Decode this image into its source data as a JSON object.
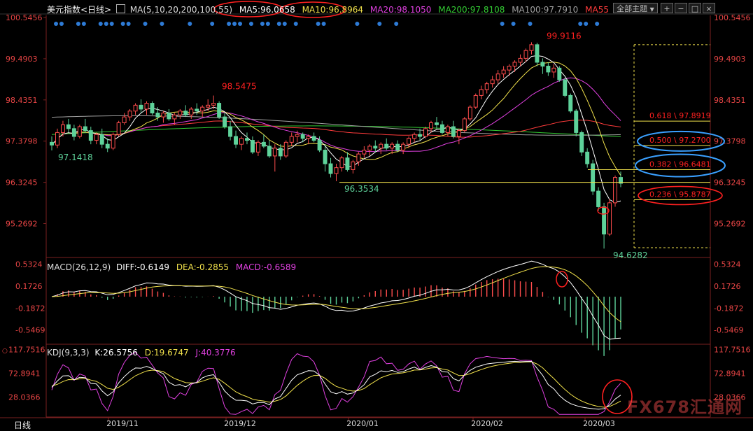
{
  "header": {
    "title": "美元指数<日线>",
    "ma_label": "MA(5,10,20,200,100,55)",
    "ma5": "MA5:96.0658",
    "ma10": "MA10:96.8964",
    "ma20": "MA20:98.1050",
    "ma200": "MA200:97.8108",
    "ma100": "MA100:97.7910",
    "ma55": "MA55",
    "select_label": "全部主题",
    "select_arrow": "▼"
  },
  "macd": {
    "label": "MACD(26,12,9)",
    "diff": "DIFF:-0.6149",
    "dea": "DEA:-0.2855",
    "macd": "MACD:-0.6589"
  },
  "kdj": {
    "label": "KDJ(9,3,3)",
    "k": "K:26.5756",
    "d": "D:19.6747",
    "j": "J:40.3776"
  },
  "footer": {
    "period": "日线",
    "dates": [
      "2019/11",
      "2019/12",
      "2020/01",
      "2020/02",
      "2020/03"
    ]
  },
  "watermark": "FX678汇通网",
  "colors": {
    "up": "#ff4d4d",
    "down": "#5ed29a",
    "ma5": "#ffffff",
    "ma10": "#f0e04b",
    "ma20": "#e040e0",
    "ma200": "#33cc33",
    "ma100": "#a0a0a0",
    "ma55": "#ff3b3b",
    "fib": "#f0e04b",
    "annotation": "#ff2020",
    "annotation_blue": "#3aa0ff"
  },
  "chart_data": [
    {
      "type": "candlestick",
      "title": "美元指数<日线>",
      "y_ticks": [
        "100.5456",
        "99.4903",
        "98.4351",
        "97.3798",
        "96.3245",
        "95.2692"
      ],
      "ylim": [
        94.4,
        100.6
      ],
      "x_ticks": [
        "2019/11",
        "2019/12",
        "2020/01",
        "2020/02",
        "2020/03"
      ],
      "candles": [
        [
          97.35,
          97.5,
          97.1418,
          97.28
        ],
        [
          97.28,
          97.7,
          97.2,
          97.6
        ],
        [
          97.6,
          97.9,
          97.5,
          97.8
        ],
        [
          97.8,
          97.95,
          97.6,
          97.7
        ],
        [
          97.7,
          97.8,
          97.4,
          97.5
        ],
        [
          97.5,
          97.8,
          97.45,
          97.75
        ],
        [
          97.75,
          97.95,
          97.6,
          97.65
        ],
        [
          97.65,
          97.75,
          97.3,
          97.4
        ],
        [
          97.4,
          97.6,
          97.3,
          97.55
        ],
        [
          97.55,
          97.7,
          97.2,
          97.3
        ],
        [
          97.3,
          97.45,
          97.1,
          97.2
        ],
        [
          97.2,
          97.6,
          97.15,
          97.55
        ],
        [
          97.55,
          97.9,
          97.5,
          97.85
        ],
        [
          97.85,
          98.1,
          97.8,
          98.0
        ],
        [
          98.0,
          98.2,
          97.9,
          98.15
        ],
        [
          98.15,
          98.35,
          98.05,
          98.3
        ],
        [
          98.3,
          98.45,
          98.1,
          98.2
        ],
        [
          98.2,
          98.4,
          98.05,
          98.35
        ],
        [
          98.35,
          98.4,
          98.05,
          98.1
        ],
        [
          98.1,
          98.25,
          97.9,
          98.0
        ],
        [
          98.0,
          98.15,
          97.85,
          98.1
        ],
        [
          98.1,
          98.2,
          97.9,
          97.95
        ],
        [
          97.95,
          98.1,
          97.8,
          98.05
        ],
        [
          98.05,
          98.2,
          97.95,
          98.15
        ],
        [
          98.15,
          98.3,
          98.0,
          98.05
        ],
        [
          98.05,
          98.25,
          97.95,
          98.2
        ],
        [
          98.2,
          98.35,
          98.05,
          98.15
        ],
        [
          98.15,
          98.3,
          98.0,
          98.25
        ],
        [
          98.25,
          98.45,
          98.15,
          98.3
        ],
        [
          98.3,
          98.5475,
          98.2,
          98.35
        ],
        [
          98.35,
          98.4,
          97.95,
          98.0
        ],
        [
          98.0,
          98.1,
          97.7,
          97.75
        ],
        [
          97.75,
          97.9,
          97.4,
          97.5
        ],
        [
          97.5,
          97.65,
          97.2,
          97.3
        ],
        [
          97.3,
          97.5,
          97.15,
          97.45
        ],
        [
          97.45,
          97.6,
          97.3,
          97.4
        ],
        [
          97.4,
          97.5,
          97.05,
          97.1
        ],
        [
          97.1,
          97.4,
          97.0,
          97.35
        ],
        [
          97.35,
          97.55,
          97.2,
          97.25
        ],
        [
          97.25,
          97.4,
          96.95,
          97.0
        ],
        [
          97.0,
          97.3,
          96.6,
          97.2
        ],
        [
          97.2,
          97.3,
          96.9,
          97.0
        ],
        [
          97.0,
          97.4,
          96.95,
          97.35
        ],
        [
          97.35,
          97.6,
          97.25,
          97.5
        ],
        [
          97.5,
          97.65,
          97.35,
          97.55
        ],
        [
          97.55,
          97.6,
          97.35,
          97.45
        ],
        [
          97.45,
          97.55,
          97.3,
          97.5
        ],
        [
          97.5,
          97.6,
          97.35,
          97.4
        ],
        [
          97.4,
          97.5,
          97.1,
          97.15
        ],
        [
          97.15,
          97.3,
          96.6,
          96.8
        ],
        [
          96.8,
          96.95,
          96.45,
          96.55
        ],
        [
          96.55,
          96.8,
          96.3534,
          96.7
        ],
        [
          96.7,
          97.0,
          96.6,
          96.95
        ],
        [
          96.95,
          97.1,
          96.6,
          96.65
        ],
        [
          96.65,
          96.9,
          96.55,
          96.85
        ],
        [
          96.85,
          97.1,
          96.75,
          97.05
        ],
        [
          97.05,
          97.25,
          96.95,
          97.15
        ],
        [
          97.15,
          97.3,
          97.0,
          97.25
        ],
        [
          97.25,
          97.4,
          97.1,
          97.2
        ],
        [
          97.2,
          97.35,
          97.05,
          97.3
        ],
        [
          97.3,
          97.45,
          97.15,
          97.2
        ],
        [
          97.2,
          97.35,
          97.05,
          97.3
        ],
        [
          97.3,
          97.4,
          97.1,
          97.15
        ],
        [
          97.15,
          97.35,
          97.05,
          97.3
        ],
        [
          97.3,
          97.5,
          97.2,
          97.45
        ],
        [
          97.45,
          97.6,
          97.35,
          97.55
        ],
        [
          97.55,
          97.7,
          97.4,
          97.5
        ],
        [
          97.5,
          97.75,
          97.45,
          97.7
        ],
        [
          97.7,
          97.9,
          97.6,
          97.85
        ],
        [
          97.85,
          98.0,
          97.7,
          97.8
        ],
        [
          97.8,
          97.9,
          97.55,
          97.6
        ],
        [
          97.6,
          97.8,
          97.5,
          97.75
        ],
        [
          97.75,
          97.9,
          97.45,
          97.5
        ],
        [
          97.5,
          97.7,
          97.3,
          97.65
        ],
        [
          97.65,
          98.0,
          97.6,
          97.95
        ],
        [
          97.95,
          98.3,
          97.9,
          98.25
        ],
        [
          98.25,
          98.6,
          98.2,
          98.55
        ],
        [
          98.55,
          98.8,
          98.45,
          98.7
        ],
        [
          98.7,
          98.9,
          98.6,
          98.85
        ],
        [
          98.85,
          99.05,
          98.75,
          98.95
        ],
        [
          98.95,
          99.2,
          98.85,
          99.1
        ],
        [
          99.1,
          99.3,
          99.0,
          99.2
        ],
        [
          99.2,
          99.35,
          99.05,
          99.3
        ],
        [
          99.3,
          99.45,
          99.15,
          99.4
        ],
        [
          99.4,
          99.6,
          99.3,
          99.5
        ],
        [
          99.5,
          99.75,
          99.4,
          99.7
        ],
        [
          99.7,
          99.9116,
          99.6,
          99.85
        ],
        [
          99.85,
          99.9,
          99.3,
          99.4
        ],
        [
          99.4,
          99.5,
          99.1,
          99.3
        ],
        [
          99.3,
          99.4,
          99.05,
          99.15
        ],
        [
          99.15,
          99.35,
          99.0,
          99.25
        ],
        [
          99.25,
          99.3,
          98.9,
          98.95
        ],
        [
          98.95,
          99.0,
          98.5,
          98.55
        ],
        [
          98.55,
          98.6,
          98.1,
          98.15
        ],
        [
          98.15,
          98.2,
          97.5,
          97.6
        ],
        [
          97.6,
          97.65,
          97.0,
          97.1
        ],
        [
          97.1,
          97.2,
          96.7,
          96.8
        ],
        [
          96.8,
          96.9,
          96.0,
          96.1
        ],
        [
          96.1,
          96.2,
          95.6,
          95.7
        ],
        [
          95.7,
          95.8,
          94.6282,
          95.0
        ],
        [
          95.0,
          95.9,
          94.95,
          95.8
        ],
        [
          95.8,
          96.5,
          95.7,
          96.45
        ],
        [
          96.45,
          96.6,
          96.2,
          96.3
        ]
      ],
      "annotations": {
        "high": "99.9116",
        "low": "94.6282",
        "left_low": "97.1418",
        "mid_low": "96.3534",
        "peak_dec": "98.5475"
      },
      "fib_levels": [
        {
          "label": "0.618 \\ 97.8919",
          "value": 97.8919
        },
        {
          "label": "0.500 \\ 97.2700",
          "value": 97.27
        },
        {
          "label": "0.382 \\ 96.6481",
          "value": 96.6481
        },
        {
          "label": "0.236 \\ 95.8787",
          "value": 95.8787
        }
      ],
      "horizontal_line": 96.3245
    },
    {
      "type": "bar",
      "title": "MACD(26,12,9)",
      "y_ticks": [
        "0.5324",
        "0.1726",
        "-0.1872",
        "-0.5469"
      ],
      "ylim": [
        -0.78,
        0.62
      ],
      "last": {
        "diff": -0.6149,
        "dea": -0.2855,
        "macd": -0.6589
      }
    },
    {
      "type": "line",
      "title": "KDJ(9,3,3)",
      "y_ticks": [
        "117.7516",
        "72.8941",
        "28.0366"
      ],
      "ylim": [
        -10,
        125
      ],
      "last": {
        "k": 26.5756,
        "d": 19.6747,
        "j": 40.3776
      }
    }
  ]
}
